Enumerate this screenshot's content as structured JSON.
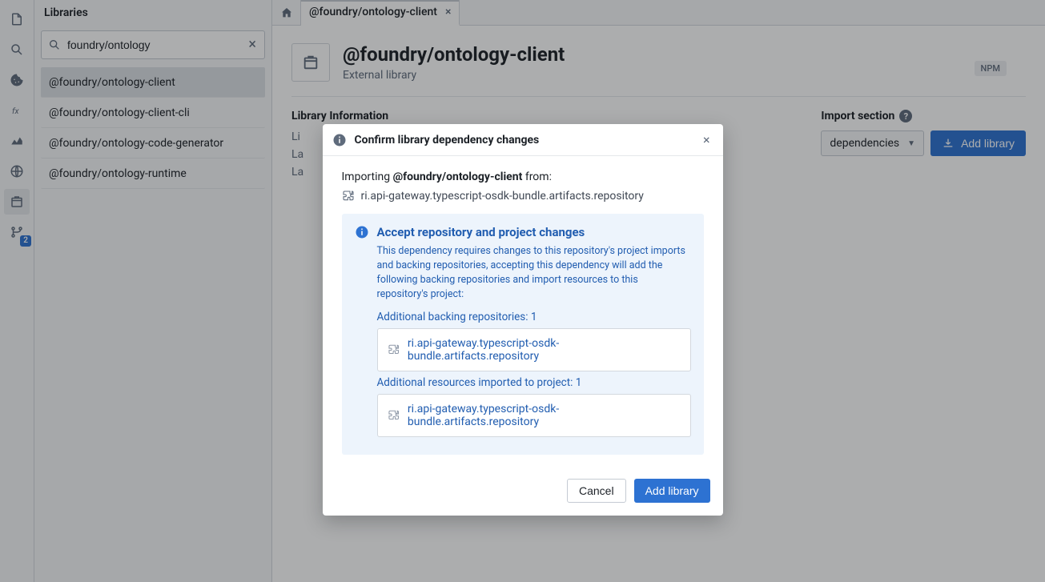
{
  "rail": {
    "branch_badge": "2"
  },
  "panel": {
    "title": "Libraries",
    "search_value": "foundry/ontology",
    "items": [
      "@foundry/ontology-client",
      "@foundry/ontology-client-cli",
      "@foundry/ontology-code-generator",
      "@foundry/ontology-runtime"
    ]
  },
  "tabs": {
    "active_label": "@foundry/ontology-client"
  },
  "library": {
    "title": "@foundry/ontology-client",
    "subtitle": "External library",
    "badge": "NPM",
    "info_section_title": "Library Information",
    "info_lines": [
      "Li",
      "La",
      "La"
    ],
    "import_section_label": "Import section",
    "dependencies_label": "dependencies",
    "add_button": "Add library"
  },
  "dialog": {
    "title": "Confirm library dependency changes",
    "importing_prefix": "Importing",
    "importing_package": "@foundry/ontology-client",
    "importing_suffix": "from:",
    "source_repo": "ri.api-gateway.typescript-osdk-bundle.artifacts.repository",
    "callout_title": "Accept repository and project changes",
    "callout_text": "This dependency requires changes to this repository's project imports and backing repositories, accepting this dependency will add the following backing repositories and import resources to this repository's project:",
    "backing_label": "Additional backing repositories: 1",
    "backing_repo": "ri.api-gateway.typescript-osdk-bundle.artifacts.repository",
    "resources_label": "Additional resources imported to project: 1",
    "resources_repo": "ri.api-gateway.typescript-osdk-bundle.artifacts.repository",
    "cancel": "Cancel",
    "confirm": "Add library"
  }
}
